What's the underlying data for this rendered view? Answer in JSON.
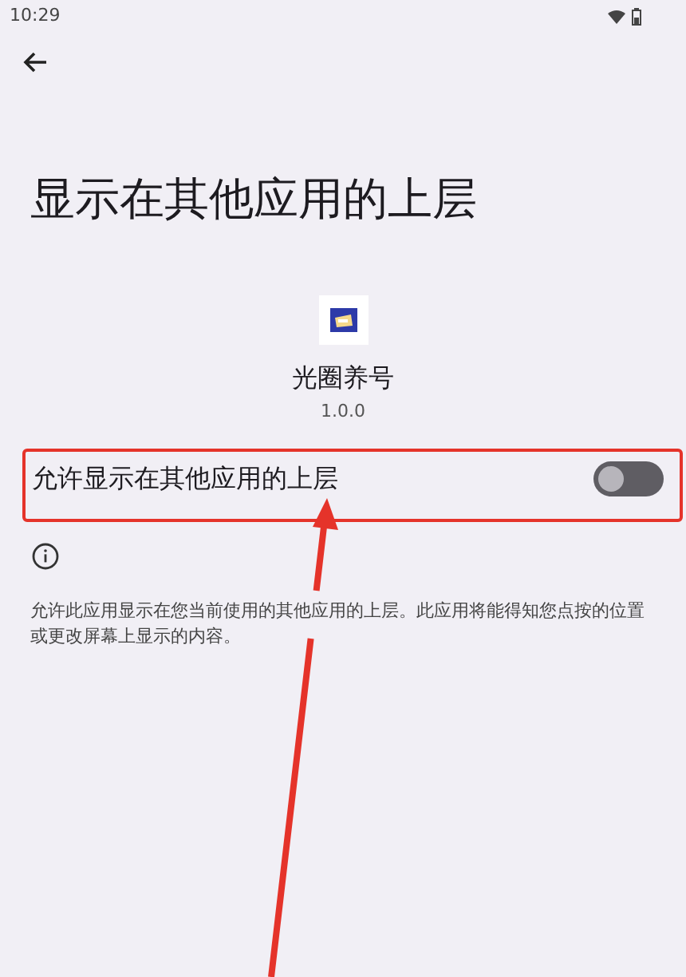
{
  "status_bar": {
    "time": "10:29"
  },
  "title": "显示在其他应用的上层",
  "app": {
    "name": "光圈养号",
    "version": "1.0.0"
  },
  "setting": {
    "label": "允许显示在其他应用的上层",
    "on": false
  },
  "description": "允许此应用显示在您当前使用的其他应用的上层。此应用将能得知您点按的位置或更改屏幕上显示的内容。"
}
